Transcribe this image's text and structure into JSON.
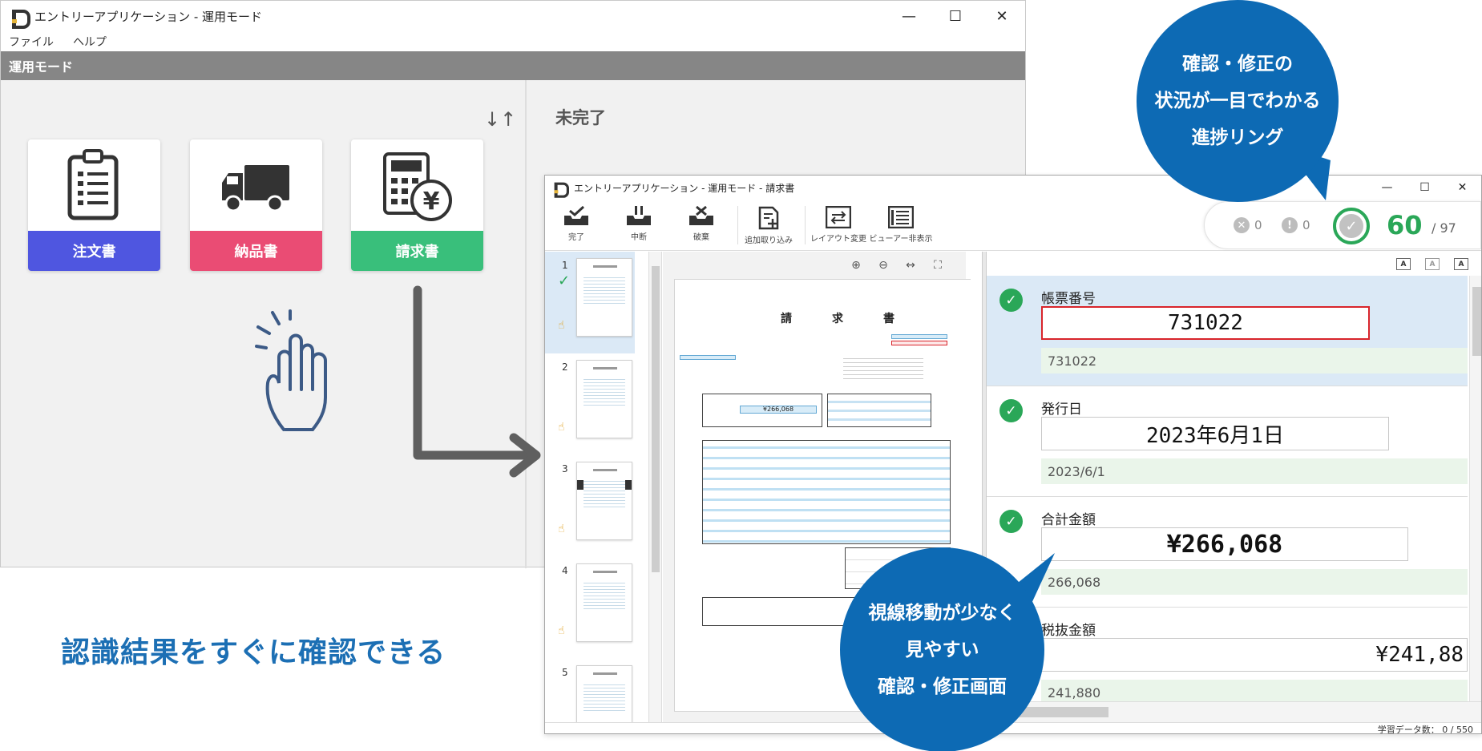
{
  "main_window": {
    "title": "エントリーアプリケーション - 運用モード",
    "controls": {
      "minimize": "—",
      "maximize": "☐",
      "close": "✕"
    },
    "menu": [
      "ファイル",
      "ヘルプ"
    ],
    "mode_bar": "運用モード",
    "sort_icon": "↓↑",
    "section_title": "未完了",
    "cards": [
      {
        "label": "注文書",
        "icon": "clipboard-icon",
        "color": "#4f56e0"
      },
      {
        "label": "納品書",
        "icon": "truck-icon",
        "color": "#ea4c74"
      },
      {
        "label": "請求書",
        "icon": "calculator-yen-icon",
        "color": "#39bf7b"
      }
    ]
  },
  "caption": "認識結果をすぐに確認できる",
  "entry_window": {
    "title": "エントリーアプリケーション - 運用モード - 請求書",
    "controls": {
      "minimize": "—",
      "maximize": "☐",
      "close": "✕"
    },
    "toolbar": [
      {
        "label": "完了",
        "icon": "tray-check-icon"
      },
      {
        "label": "中断",
        "icon": "tray-pause-icon"
      },
      {
        "label": "破棄",
        "icon": "tray-x-icon"
      },
      {
        "label": "追加取り込み",
        "icon": "add-document-icon"
      },
      {
        "label": "レイアウト変更",
        "icon": "layout-swap-icon"
      },
      {
        "label": "ビューアー非表示",
        "icon": "viewer-list-icon"
      }
    ],
    "progress": {
      "error_count": "0",
      "warning_count": "0",
      "done": "60",
      "total": "/ 97",
      "accent": "#2aa758"
    },
    "thumbnails": [
      {
        "num": "1",
        "checked": true
      },
      {
        "num": "2"
      },
      {
        "num": "3"
      },
      {
        "num": "4"
      },
      {
        "num": "5"
      }
    ],
    "document": {
      "title": "請　求　書",
      "total_text": "¥266,068"
    },
    "viewer_tools": [
      "⊕",
      "⊖",
      "↔",
      "⛶"
    ],
    "text_size_buttons": [
      "A",
      "A",
      "A"
    ],
    "fields": [
      {
        "name": "帳票番号",
        "value": "731022",
        "ocr": "731022",
        "error": true
      },
      {
        "name": "発行日",
        "value": "2023年6月1日",
        "ocr": "2023/6/1"
      },
      {
        "name": "合計金額",
        "value": "¥266,068",
        "ocr": "266,068"
      },
      {
        "name": "税抜金額",
        "value": "¥241,88",
        "ocr": "241,880"
      }
    ],
    "status": {
      "label": "学習データ数：",
      "value": "0 / 550"
    }
  },
  "callouts": {
    "top": [
      "確認・修正の",
      "状況が一目でわかる",
      "進捗リング"
    ],
    "bottom": [
      "視線移動が少なく",
      "見やすい",
      "確認・修正画面"
    ],
    "color": "#0d6ab4"
  }
}
